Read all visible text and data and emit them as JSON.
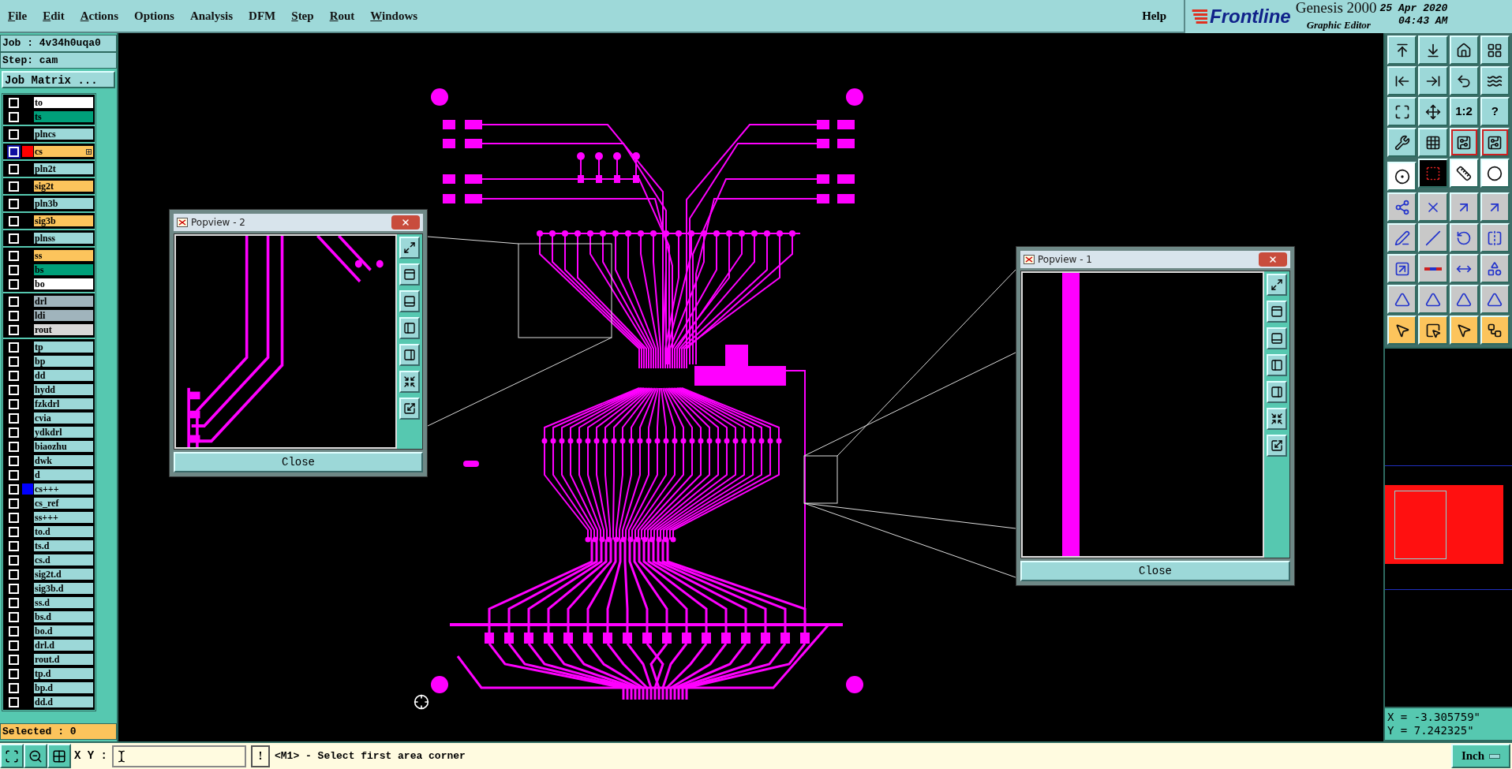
{
  "menu": {
    "items": [
      {
        "label": "File",
        "underlined": true
      },
      {
        "label": "Edit",
        "underlined": true
      },
      {
        "label": "Actions",
        "underlined": true
      },
      {
        "label": "Options",
        "underlined": false
      },
      {
        "label": "Analysis",
        "underlined": false
      },
      {
        "label": "DFM",
        "underlined": false
      },
      {
        "label": "Step",
        "underlined": true
      },
      {
        "label": "Rout",
        "underlined": true
      },
      {
        "label": "Windows",
        "underlined": true
      }
    ],
    "help": "Help"
  },
  "header": {
    "brand": "Frontline",
    "product": "Genesis 2000",
    "subtitle": "Graphic Editor",
    "date": "25 Apr 2020",
    "time": "04:43 AM"
  },
  "sidebar": {
    "job": "Job : 4v34h0uqa0",
    "step": "Step: cam",
    "matrix_button": "Job Matrix ...",
    "selected": "Selected : 0",
    "layer_groups": [
      [
        {
          "name": "to",
          "color": "#ffffff",
          "work": false,
          "expandable": false
        },
        {
          "name": "ts",
          "color": "#00a07a",
          "work": false,
          "expandable": false
        }
      ],
      [
        {
          "name": "plncs",
          "color": "#9cd8d8",
          "work": false,
          "expandable": false
        }
      ],
      [
        {
          "name": "cs",
          "color": "#fcc45c",
          "work": true,
          "tag": {
            "color": "#ff0000"
          },
          "expandable": true
        }
      ],
      [
        {
          "name": "pln2t",
          "color": "#9cd8d8",
          "work": false,
          "expandable": false
        }
      ],
      [
        {
          "name": "sig2t",
          "color": "#fcc45c",
          "work": false,
          "expandable": false
        }
      ],
      [
        {
          "name": "pln3b",
          "color": "#9cd8d8",
          "work": false,
          "expandable": false
        }
      ],
      [
        {
          "name": "sig3b",
          "color": "#fcc45c",
          "work": false,
          "expandable": false
        }
      ],
      [
        {
          "name": "plnss",
          "color": "#9cd8d8",
          "work": false,
          "expandable": false
        }
      ],
      [
        {
          "name": "ss",
          "color": "#fcc45c",
          "work": false,
          "expandable": false
        },
        {
          "name": "bs",
          "color": "#00a07a",
          "work": false,
          "expandable": false
        },
        {
          "name": "bo",
          "color": "#ffffff",
          "work": false,
          "expandable": false
        }
      ],
      [
        {
          "name": "drl",
          "color": "#a0b4bc",
          "work": false,
          "expandable": false
        },
        {
          "name": "ldi",
          "color": "#a0b4bc",
          "work": false,
          "expandable": false
        },
        {
          "name": "rout",
          "color": "#d8d8d8",
          "work": false,
          "expandable": false
        }
      ],
      [
        {
          "name": "tp",
          "color": "#9cd8d8",
          "work": false,
          "expandable": false
        },
        {
          "name": "bp",
          "color": "#9cd8d8",
          "work": false,
          "expandable": false
        },
        {
          "name": "dd",
          "color": "#9cd8d8",
          "work": false,
          "expandable": false
        },
        {
          "name": "hydd",
          "color": "#9cd8d8",
          "work": false,
          "expandable": false
        },
        {
          "name": "fzkdrl",
          "color": "#9cd8d8",
          "work": false,
          "expandable": false
        },
        {
          "name": "cvia",
          "color": "#9cd8d8",
          "work": false,
          "expandable": false
        },
        {
          "name": "ydkdrl",
          "color": "#9cd8d8",
          "work": false,
          "expandable": false
        },
        {
          "name": "biaozhu",
          "color": "#9cd8d8",
          "work": false,
          "expandable": false
        },
        {
          "name": "dwk",
          "color": "#9cd8d8",
          "work": false,
          "expandable": false
        },
        {
          "name": "d",
          "color": "#9cd8d8",
          "work": false,
          "expandable": false
        },
        {
          "name": "cs+++",
          "color": "#9cd8d8",
          "work": false,
          "tag": {
            "color": "#0000ff"
          },
          "expandable": false
        },
        {
          "name": "cs_ref",
          "color": "#9cd8d8",
          "work": false,
          "expandable": false
        },
        {
          "name": "ss+++",
          "color": "#9cd8d8",
          "work": false,
          "expandable": false
        },
        {
          "name": "to.d",
          "color": "#9cd8d8",
          "work": false,
          "expandable": false
        },
        {
          "name": "ts.d",
          "color": "#9cd8d8",
          "work": false,
          "expandable": false
        },
        {
          "name": "cs.d",
          "color": "#9cd8d8",
          "work": false,
          "expandable": false
        },
        {
          "name": "sig2t.d",
          "color": "#9cd8d8",
          "work": false,
          "expandable": false
        },
        {
          "name": "sig3b.d",
          "color": "#9cd8d8",
          "work": false,
          "expandable": false
        },
        {
          "name": "ss.d",
          "color": "#9cd8d8",
          "work": false,
          "expandable": false
        },
        {
          "name": "bs.d",
          "color": "#9cd8d8",
          "work": false,
          "expandable": false
        },
        {
          "name": "bo.d",
          "color": "#9cd8d8",
          "work": false,
          "expandable": false
        },
        {
          "name": "drl.d",
          "color": "#9cd8d8",
          "work": false,
          "expandable": false
        },
        {
          "name": "rout.d",
          "color": "#9cd8d8",
          "work": false,
          "expandable": false
        },
        {
          "name": "tp.d",
          "color": "#9cd8d8",
          "work": false,
          "expandable": false
        },
        {
          "name": "bp.d",
          "color": "#9cd8d8",
          "work": false,
          "expandable": false
        },
        {
          "name": "dd.d",
          "color": "#9cd8d8",
          "work": false,
          "expandable": false
        }
      ]
    ]
  },
  "popviews": [
    {
      "title": "Popview - 2",
      "close_label": "Close",
      "kind": "traces"
    },
    {
      "title": "Popview - 1",
      "close_label": "Close",
      "kind": "bar"
    }
  ],
  "tools": [
    {
      "kind": "view",
      "on": false
    },
    {
      "kind": "view",
      "on": false
    },
    {
      "kind": "view",
      "on": false
    },
    {
      "kind": "view",
      "on": false
    },
    {
      "kind": "view",
      "on": false
    },
    {
      "kind": "view",
      "on": false
    },
    {
      "kind": "view",
      "on": false
    },
    {
      "kind": "view",
      "on": false
    },
    {
      "kind": "view",
      "on": false
    },
    {
      "kind": "view",
      "on": false
    },
    {
      "kind": "view",
      "label": "1:2",
      "on": false
    },
    {
      "kind": "view",
      "label": "?",
      "on": false
    },
    {
      "kind": "view",
      "on": false
    },
    {
      "kind": "view",
      "on": false
    },
    {
      "kind": "view",
      "on": true
    },
    {
      "kind": "view",
      "on": true
    },
    {
      "kind": "measure",
      "on": false
    },
    {
      "kind": "dark",
      "on": false
    },
    {
      "kind": "measure",
      "on": false
    },
    {
      "kind": "measure",
      "on": false
    },
    {
      "kind": "edit",
      "on": false
    },
    {
      "kind": "edit",
      "on": false
    },
    {
      "kind": "edit",
      "on": false
    },
    {
      "kind": "edit",
      "on": false
    },
    {
      "kind": "edit",
      "on": false
    },
    {
      "kind": "edit",
      "on": false
    },
    {
      "kind": "edit",
      "on": false
    },
    {
      "kind": "edit",
      "on": false
    },
    {
      "kind": "edit",
      "on": false
    },
    {
      "kind": "edit",
      "on": false
    },
    {
      "kind": "edit",
      "on": false
    },
    {
      "kind": "edit",
      "on": false
    },
    {
      "kind": "edit",
      "on": false
    },
    {
      "kind": "edit",
      "on": false
    },
    {
      "kind": "edit",
      "on": false
    },
    {
      "kind": "edit",
      "on": false
    },
    {
      "kind": "select",
      "on": false
    },
    {
      "kind": "select",
      "on": false
    },
    {
      "kind": "select",
      "on": false
    },
    {
      "kind": "select",
      "on": false
    }
  ],
  "coordinates": {
    "x": "X = -3.305759\"",
    "y": "Y = 7.242325\""
  },
  "status_bar": {
    "xy_label": "X Y :",
    "bang": "!",
    "message": "<M1> - Select first area corner",
    "units": "Inch"
  }
}
